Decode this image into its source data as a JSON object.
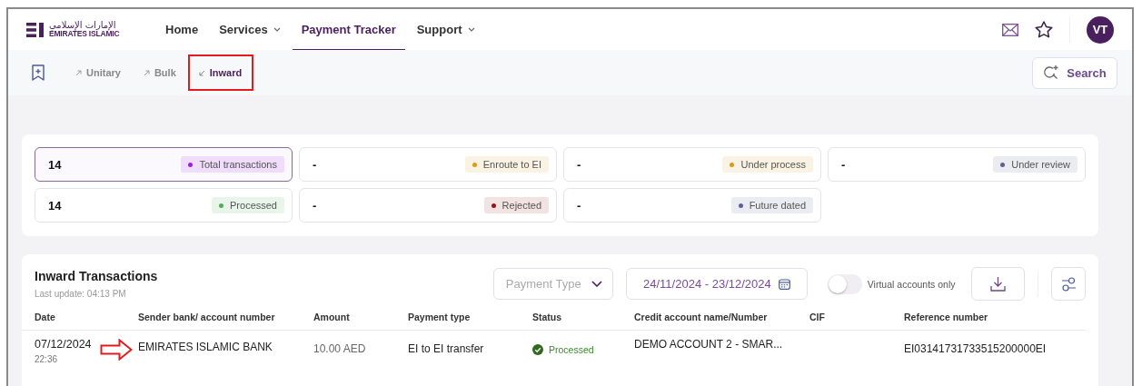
{
  "logo": {
    "arabic": "الإمارات الإسلامي",
    "english": "EMIRATES ISLAMIC"
  },
  "nav": [
    {
      "label": "Home",
      "selected": false,
      "dropdown": false
    },
    {
      "label": "Services",
      "selected": false,
      "dropdown": true
    },
    {
      "label": "Payment Tracker",
      "selected": true,
      "dropdown": false
    },
    {
      "label": "Support",
      "selected": false,
      "dropdown": true
    }
  ],
  "user": {
    "initials": "VT"
  },
  "subtabs": [
    {
      "label": "Unitary",
      "selected": false,
      "highlighted": false
    },
    {
      "label": "Bulk",
      "selected": false,
      "highlighted": false
    },
    {
      "label": "Inward",
      "selected": true,
      "highlighted": true
    }
  ],
  "search_button": "Search",
  "stats": [
    {
      "value": "14",
      "label": "Total transactions",
      "color": "#9b1fe8",
      "selected": true
    },
    {
      "value": "-",
      "label": "Enroute to EI",
      "color": "#d99a1a",
      "selected": false
    },
    {
      "value": "-",
      "label": "Under process",
      "color": "#d99a1a",
      "selected": false
    },
    {
      "value": "-",
      "label": "Under review",
      "color": "#5c6098",
      "selected": false
    },
    {
      "value": "14",
      "label": "Processed",
      "color": "#4caf50",
      "selected": false
    },
    {
      "value": "-",
      "label": "Rejected",
      "color": "#a01010",
      "selected": false
    },
    {
      "value": "-",
      "label": "Future dated",
      "color": "#5c6098",
      "selected": false
    }
  ],
  "table": {
    "title": "Inward Transactions",
    "last_update": "Last update: 04:13 PM",
    "payment_type": {
      "placeholder": "Payment Type"
    },
    "date_range": "24/11/2024 - 23/12/2024",
    "virtual_only": {
      "label": "Virtual accounts only",
      "on": false
    },
    "columns": [
      "Date",
      "Sender bank/ account number",
      "Amount",
      "Payment type",
      "Status",
      "Credit account name/Number",
      "CIF",
      "Reference number"
    ],
    "rows": [
      {
        "date": "07/12/2024",
        "time": "22:36",
        "sender": "EMIRATES ISLAMIC BANK",
        "amount": "10.00 AED",
        "payment_type": "EI to EI transfer",
        "status": "Processed",
        "credit_account": "DEMO ACCOUNT 2 - SMAR...",
        "cif": "",
        "reference": "EI03141731733515200000EI",
        "marked": true
      }
    ]
  }
}
